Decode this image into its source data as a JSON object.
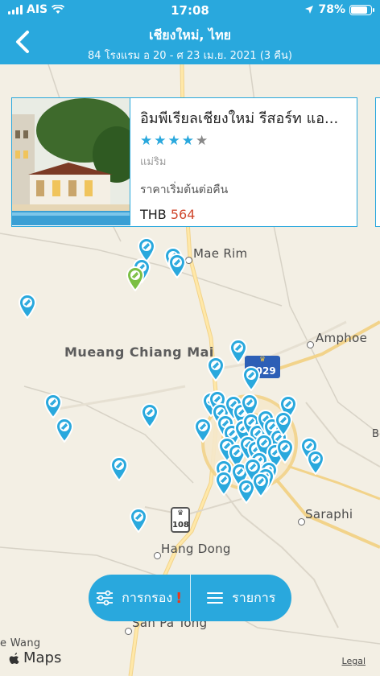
{
  "status_bar": {
    "carrier": "AIS",
    "time": "17:08",
    "battery": "78%",
    "battery_level": 0.78
  },
  "header": {
    "title": "เชียงใหม่, ไทย",
    "subtitle": "84 โรงแรม อ 20 - ศ 23 เม.ย. 2021 (3 คืน)"
  },
  "hotel_card": {
    "name": "อิมพีเรียลเชียงใหม่ รีสอร์ท แอ...",
    "stars": 4,
    "max_stars": 5,
    "area": "แม่ริม",
    "price_label": "ราคาเริ่มต้นต่อคืน",
    "currency": "THB",
    "price": "564"
  },
  "map": {
    "places": {
      "mae_rim": "Mae Rim",
      "mueang": "Mueang Chiang Mai",
      "amphoe": "Amphoe",
      "saraphi": "Saraphi",
      "hang_dong": "Hang Dong",
      "san_pa_tong": "San Pa Tong",
      "wang": "e Wang"
    },
    "route_3029": "3029",
    "route_108": "108",
    "attribution": "Maps",
    "legal": "Legal"
  },
  "bottom_bar": {
    "filter_label": "การกรอง",
    "filter_alert": "!",
    "list_label": "รายการ"
  },
  "colors": {
    "brand": "#29a8dd",
    "price": "#d0492f",
    "selected_pin": "#7bbf44"
  }
}
